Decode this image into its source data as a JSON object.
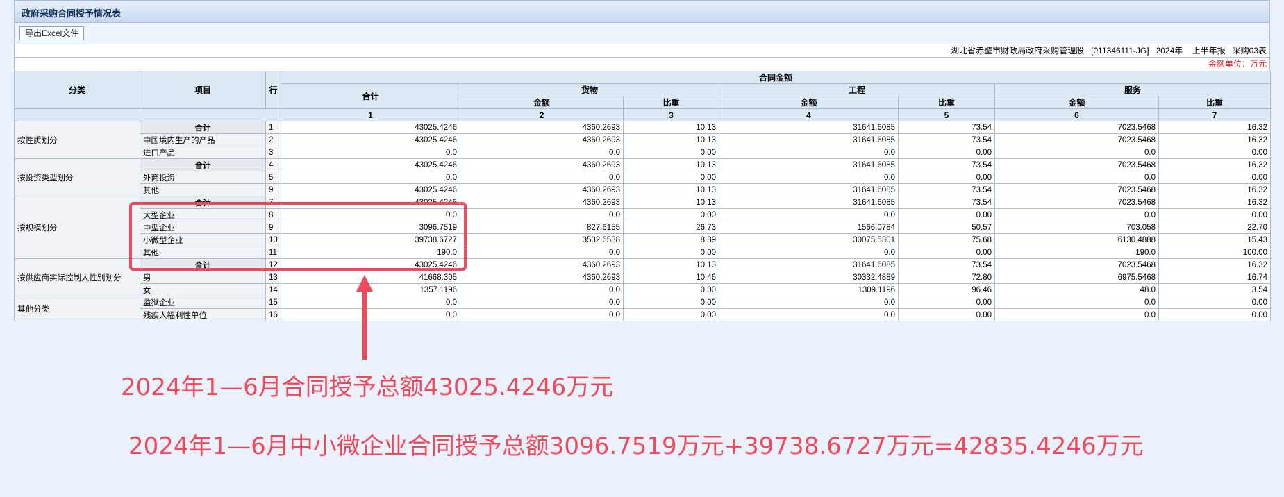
{
  "window": {
    "title": "政府采购合同授予情况表"
  },
  "toolbar": {
    "export_label": "导出Excel文件"
  },
  "report_meta": {
    "org": "湖北省赤壁市财政局政府采购管理股",
    "code": "[011346111-JG]",
    "year": "2024年",
    "period": "上半年报",
    "form": "采购03表"
  },
  "unit_label": "金额单位：万元",
  "header": {
    "category": "分类",
    "item": "项目",
    "row": "行",
    "contract_amount": "合同金额",
    "total": "合计",
    "goods": "货物",
    "engineering": "工程",
    "services": "服务",
    "amount": "金额",
    "ratio": "比重",
    "col_numbers": [
      "1",
      "2",
      "3",
      "4",
      "5",
      "6",
      "7"
    ]
  },
  "categories": [
    {
      "name": "按性质划分",
      "rows": [
        {
          "item": "合计",
          "subtotal": true,
          "row": "1",
          "total": "43025.4246",
          "goods_amt": "4360.2693",
          "goods_ratio": "10.13",
          "eng_amt": "31641.6085",
          "eng_ratio": "73.54",
          "svc_amt": "7023.5468",
          "svc_ratio": "16.32"
        },
        {
          "item": "中国境内生产的产品",
          "subtotal": false,
          "row": "2",
          "total": "43025.4246",
          "goods_amt": "4360.2693",
          "goods_ratio": "10.13",
          "eng_amt": "31641.6085",
          "eng_ratio": "73.54",
          "svc_amt": "7023.5468",
          "svc_ratio": "16.32"
        },
        {
          "item": "进口产品",
          "subtotal": false,
          "row": "3",
          "total": "0.0",
          "goods_amt": "0.0",
          "goods_ratio": "0.00",
          "eng_amt": "0.0",
          "eng_ratio": "0.00",
          "svc_amt": "0.0",
          "svc_ratio": "0.00"
        }
      ]
    },
    {
      "name": "按投资类型划分",
      "rows": [
        {
          "item": "合计",
          "subtotal": true,
          "row": "4",
          "total": "43025.4246",
          "goods_amt": "4360.2693",
          "goods_ratio": "10.13",
          "eng_amt": "31641.6085",
          "eng_ratio": "73.54",
          "svc_amt": "7023.5468",
          "svc_ratio": "16.32"
        },
        {
          "item": "外商投资",
          "subtotal": false,
          "row": "5",
          "total": "0.0",
          "goods_amt": "0.0",
          "goods_ratio": "0.00",
          "eng_amt": "0.0",
          "eng_ratio": "0.00",
          "svc_amt": "0.0",
          "svc_ratio": "0.00"
        },
        {
          "item": "其他",
          "subtotal": false,
          "row": "9",
          "total": "43025.4246",
          "goods_amt": "4360.2693",
          "goods_ratio": "10.13",
          "eng_amt": "31641.6085",
          "eng_ratio": "73.54",
          "svc_amt": "7023.5468",
          "svc_ratio": "16.32"
        }
      ]
    },
    {
      "name": "按规模划分",
      "rows": [
        {
          "item": "合计",
          "subtotal": true,
          "row": "7",
          "total": "43025.4246",
          "goods_amt": "4360.2693",
          "goods_ratio": "10.13",
          "eng_amt": "31641.6085",
          "eng_ratio": "73.54",
          "svc_amt": "7023.5468",
          "svc_ratio": "16.32"
        },
        {
          "item": "大型企业",
          "subtotal": false,
          "row": "8",
          "total": "0.0",
          "goods_amt": "0.0",
          "goods_ratio": "0.00",
          "eng_amt": "0.0",
          "eng_ratio": "0.00",
          "svc_amt": "0.0",
          "svc_ratio": "0.00"
        },
        {
          "item": "中型企业",
          "subtotal": false,
          "row": "9",
          "total": "3096.7519",
          "goods_amt": "827.6155",
          "goods_ratio": "26.73",
          "eng_amt": "1566.0784",
          "eng_ratio": "50.57",
          "svc_amt": "703.058",
          "svc_ratio": "22.70"
        },
        {
          "item": "小微型企业",
          "subtotal": false,
          "row": "10",
          "total": "39738.6727",
          "goods_amt": "3532.6538",
          "goods_ratio": "8.89",
          "eng_amt": "30075.5301",
          "eng_ratio": "75.68",
          "svc_amt": "6130.4888",
          "svc_ratio": "15.43"
        },
        {
          "item": "其他",
          "subtotal": false,
          "row": "11",
          "total": "190.0",
          "goods_amt": "0.0",
          "goods_ratio": "0.00",
          "eng_amt": "0.0",
          "eng_ratio": "0.00",
          "svc_amt": "190.0",
          "svc_ratio": "100.00"
        }
      ]
    },
    {
      "name": "按供应商实际控制人性别划分",
      "rows": [
        {
          "item": "合计",
          "subtotal": true,
          "row": "12",
          "total": "43025.4246",
          "goods_amt": "4360.2693",
          "goods_ratio": "10.13",
          "eng_amt": "31641.6085",
          "eng_ratio": "73.54",
          "svc_amt": "7023.5468",
          "svc_ratio": "16.32"
        },
        {
          "item": "男",
          "subtotal": false,
          "row": "13",
          "total": "41668.305",
          "goods_amt": "4360.2693",
          "goods_ratio": "10.46",
          "eng_amt": "30332.4889",
          "eng_ratio": "72.80",
          "svc_amt": "6975.5468",
          "svc_ratio": "16.74"
        },
        {
          "item": "女",
          "subtotal": false,
          "row": "14",
          "total": "1357.1196",
          "goods_amt": "0.0",
          "goods_ratio": "0.00",
          "eng_amt": "1309.1196",
          "eng_ratio": "96.46",
          "svc_amt": "48.0",
          "svc_ratio": "3.54"
        }
      ]
    },
    {
      "name": "其他分类",
      "rows": [
        {
          "item": "监狱企业",
          "subtotal": false,
          "row": "15",
          "total": "0.0",
          "goods_amt": "0.0",
          "goods_ratio": "0.00",
          "eng_amt": "0.0",
          "eng_ratio": "0.00",
          "svc_amt": "0.0",
          "svc_ratio": "0.00"
        },
        {
          "item": "残疾人福利性单位",
          "subtotal": false,
          "row": "16",
          "total": "0.0",
          "goods_amt": "0.0",
          "goods_ratio": "0.00",
          "eng_amt": "0.0",
          "eng_ratio": "0.00",
          "svc_amt": "0.0",
          "svc_ratio": "0.00"
        }
      ]
    }
  ],
  "annotations": {
    "note1": "2024年1—6月合同授予总额43025.4246万元",
    "note2": "2024年1—6月中小微企业合同授予总额3096.7519万元+39738.6727万元=42835.4246万元"
  },
  "colors": {
    "highlight": "#ee4a5c",
    "header_bg": "#dde8f5",
    "unit_text": "#e0202a"
  }
}
